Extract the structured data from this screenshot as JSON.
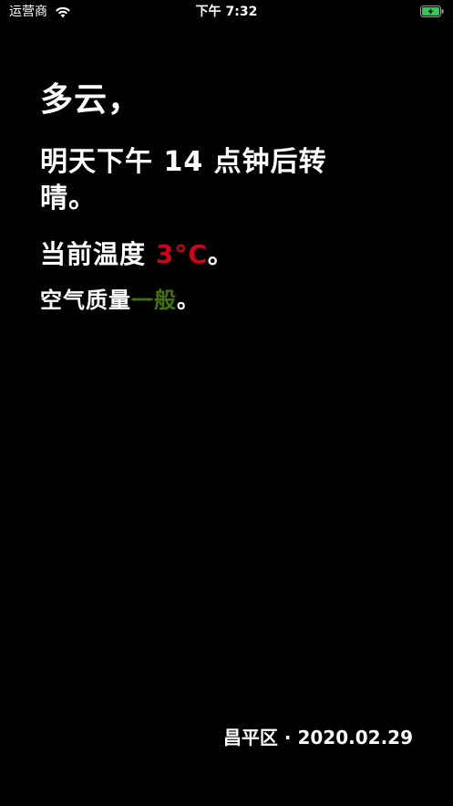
{
  "status_bar": {
    "carrier": "运营商",
    "time": "下午 7:32",
    "wifi_icon": "wifi-icon",
    "battery_icon": "battery-charging-icon",
    "battery_color": "#34c759"
  },
  "weather": {
    "condition": "多云，",
    "forecast": "明天下午 14 点钟后转晴。",
    "temp_prefix": "当前温度 ",
    "temp_value": "3°C",
    "temp_suffix": "。",
    "air_prefix": "空气质量",
    "air_value": "一般",
    "air_suffix": "。",
    "colors": {
      "temperature": "#d0021b",
      "air_quality": "#417505"
    }
  },
  "footer": {
    "location": "昌平区",
    "separator": " · ",
    "date": "2020.02.29"
  }
}
